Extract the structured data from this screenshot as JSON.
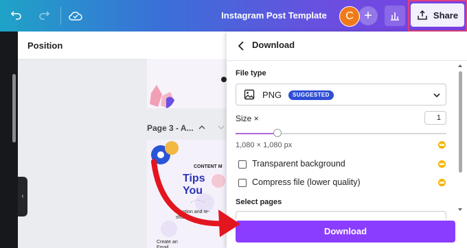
{
  "topbar": {
    "title": "Instagram Post Template",
    "avatar_initial": "C",
    "add_symbol": "+",
    "share_label": "Share",
    "icons": [
      "undo-icon",
      "redo-icon",
      "cloud-save-icon",
      "stats-icon",
      "share-upload-icon"
    ]
  },
  "left": {
    "position_label": "Position",
    "page_label": "Page 3 - A...",
    "collapse_symbol": "‹",
    "thumb": {
      "heading_small": "CONTENT M",
      "heading_big": "Tips You",
      "item_1": "Mention and re-share",
      "item_2": "Create an Email"
    }
  },
  "panel": {
    "title": "Download",
    "file_type_label": "File type",
    "file_type_value": "PNG",
    "suggested_badge": "SUGGESTED",
    "size_label": "Size ×",
    "size_value": "1",
    "size_slider_fraction": 0.2,
    "dimensions": "1,080 × 1,080 px",
    "options": [
      {
        "label": "Transparent background",
        "checked": false
      },
      {
        "label": "Compress file (lower quality)",
        "checked": false
      }
    ],
    "select_pages_label": "Select pages",
    "download_button": "Download"
  },
  "colors": {
    "accent": "#8b3dff",
    "badge": "#2f4fd6",
    "crown": "#f4b400",
    "highlight_border": "#e0417c",
    "arrow": "#e3151e"
  }
}
